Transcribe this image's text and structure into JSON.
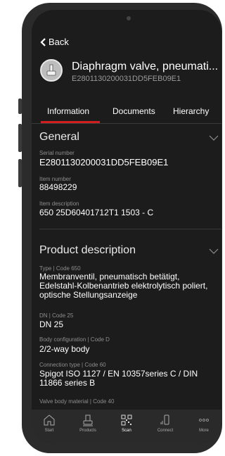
{
  "nav": {
    "back_label": "Back"
  },
  "product": {
    "title": "Diaphragm valve, pneumati...",
    "subtitle": "E2801130200031DD5FEB09E1"
  },
  "tabs": [
    {
      "label": "Information"
    },
    {
      "label": "Documents"
    },
    {
      "label": "Hierarchy"
    }
  ],
  "general": {
    "title": "General",
    "fields": [
      {
        "label": "Serial number",
        "value": "E2801130200031DD5FEB09E1"
      },
      {
        "label": "Item number",
        "value": "88498229"
      },
      {
        "label": "Item description",
        "value": "650 25D60401712T1 1503 - C"
      }
    ]
  },
  "product_description": {
    "title": "Product description",
    "fields": [
      {
        "label": "Type | Code 650",
        "value": "Membranventil, pneumatisch betätigt, Edelstahl-Kolbenantrieb elektrolytisch poliert, optische Stellungsanzeige"
      },
      {
        "label": "DN | Code 25",
        "value": "DN 25"
      },
      {
        "label": "Body configuration  | Code D",
        "value": "2/2-way body"
      },
      {
        "label": "Connection type  | Code 60",
        "value": "Spigot ISO 1127 / EN 10357series C / DIN 11866 series B"
      },
      {
        "label": "Valve body material   | Code 40",
        "value": ""
      }
    ]
  },
  "bottom_nav": [
    {
      "label": "Start",
      "icon": "home-icon"
    },
    {
      "label": "Products",
      "icon": "products-icon"
    },
    {
      "label": "Scan",
      "icon": "qr-scan-icon"
    },
    {
      "label": "Connect",
      "icon": "connect-icon"
    },
    {
      "label": "More",
      "icon": "more-icon"
    }
  ],
  "colors": {
    "accent": "#d11f1f",
    "background": "#1c1c1c",
    "muted": "#8d8d8d"
  }
}
